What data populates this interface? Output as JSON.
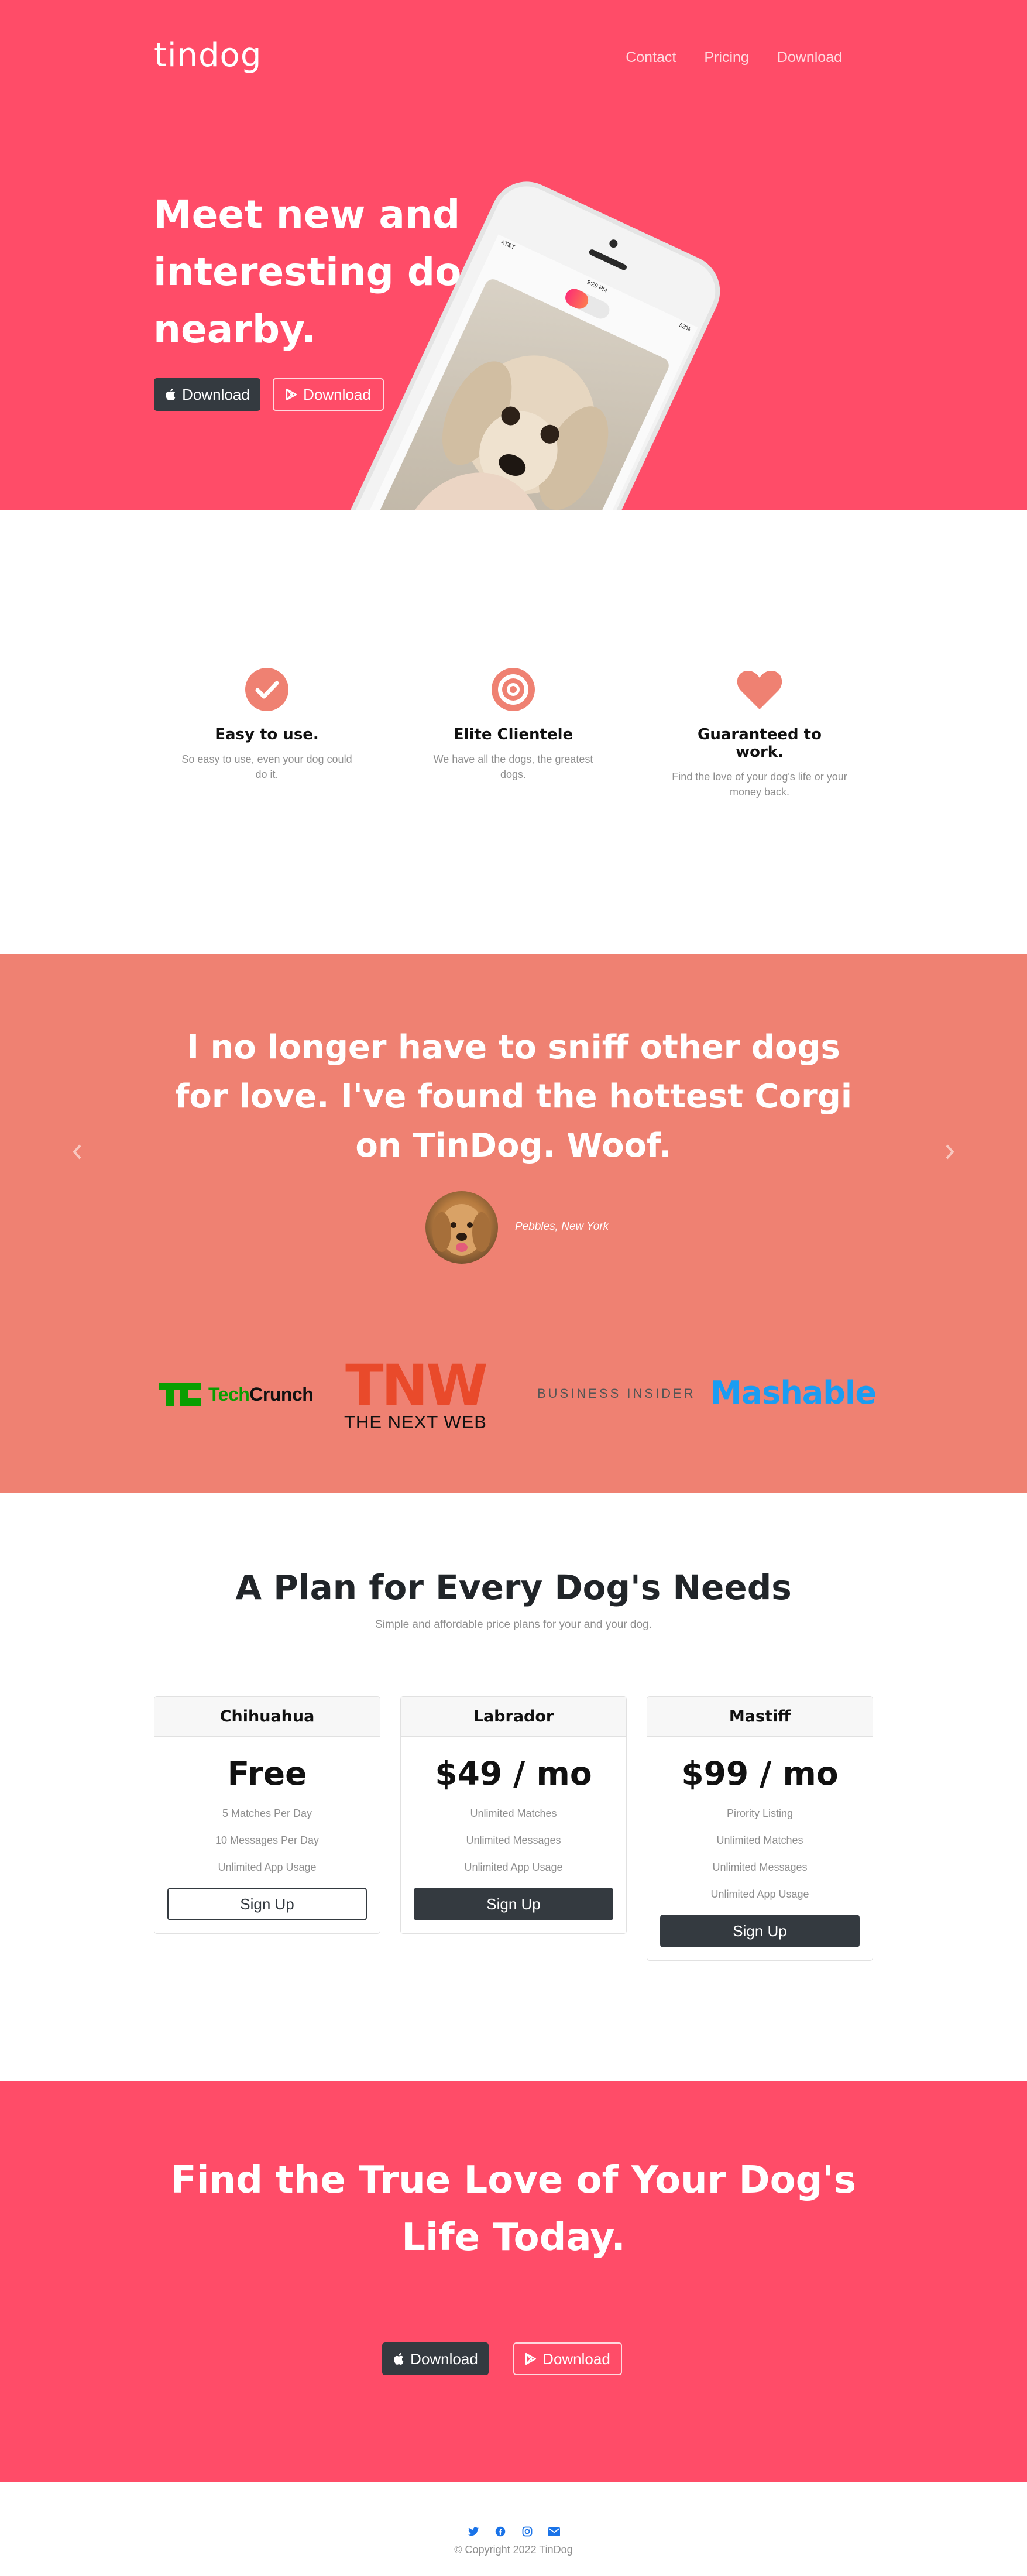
{
  "brand": "tindog",
  "nav": {
    "items": [
      "Contact",
      "Pricing",
      "Download"
    ]
  },
  "hero": {
    "title": "Meet new and interesting dogs nearby.",
    "apple_button": "Download",
    "play_button": "Download",
    "phone": {
      "carrier": "AT&T",
      "time": "9:29 PM",
      "battery": "53%"
    }
  },
  "features": [
    {
      "icon": "check-circle-icon",
      "title": "Easy to use.",
      "text": "So easy to use, even your dog could do it."
    },
    {
      "icon": "bullseye-icon",
      "title": "Elite Clientele",
      "text": "We have all the dogs, the greatest dogs."
    },
    {
      "icon": "heart-icon",
      "title": "Guaranteed to work.",
      "text": "Find the love of your dog's life or your money back."
    }
  ],
  "testimonial": {
    "quote": "I no longer have to sniff other dogs for love. I've found the hottest Corgi on TinDog. Woof.",
    "author": "Pebbles, New York"
  },
  "press": {
    "techcrunch_mark": "TC",
    "techcrunch_a": "Tech",
    "techcrunch_b": "Crunch",
    "tnw_big": "TNW",
    "tnw_small": "THE NEXT WEB",
    "business_insider": "BUSINESS INSIDER",
    "mashable": "Mashable"
  },
  "pricing": {
    "title": "A Plan for Every Dog's Needs",
    "subtitle": "Simple and affordable price plans for your and your dog.",
    "plans": [
      {
        "name": "Chihuahua",
        "price": "Free",
        "features": [
          "5 Matches Per Day",
          "10 Messages Per Day",
          "Unlimited App Usage"
        ],
        "cta": "Sign Up"
      },
      {
        "name": "Labrador",
        "price": "$49 / mo",
        "features": [
          "Unlimited Matches",
          "Unlimited Messages",
          "Unlimited App Usage"
        ],
        "cta": "Sign Up"
      },
      {
        "name": "Mastiff",
        "price": "$99 / mo",
        "features": [
          "Pirority Listing",
          "Unlimited Matches",
          "Unlimited Messages",
          "Unlimited App Usage"
        ],
        "cta": "Sign Up"
      }
    ]
  },
  "cta": {
    "title": "Find the True Love of Your Dog's Life Today.",
    "apple_button": "Download",
    "play_button": "Download"
  },
  "footer": {
    "social_icons": [
      "twitter-icon",
      "facebook-icon",
      "instagram-icon",
      "envelope-icon"
    ],
    "copyright": "© Copyright 2022 TinDog"
  },
  "colors": {
    "brand_red": "#ff4c68",
    "testimonial_bg": "#ef8172",
    "dark_button": "#343a40",
    "icon_coral": "#ef8172",
    "social_blue": "#1a73e8"
  }
}
